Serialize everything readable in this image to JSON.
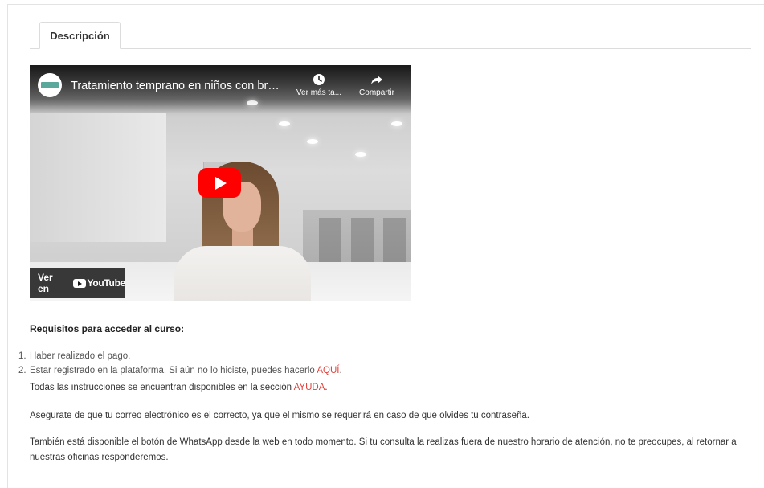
{
  "tabs": [
    {
      "label": "Descripción"
    }
  ],
  "video": {
    "title": "Tratamiento temprano en niños con brac...",
    "channel_logo_icon": "channel-logo-icon",
    "actions": [
      {
        "label": "Ver más ta...",
        "icon": "clock-icon"
      },
      {
        "label": "Compartir",
        "icon": "share-icon"
      }
    ],
    "watch_on_label": "Ver en",
    "youtube_label": "YouTube",
    "play_color": "#ff0000"
  },
  "requirements": {
    "title": "Requisitos para acceder al curso:",
    "items": [
      {
        "number": "1.",
        "text": "Haber realizado el pago."
      },
      {
        "number": "2.",
        "text": "Estar registrado en la plataforma. Si aún no lo hiciste, puedes hacerlo ",
        "link": "AQUÍ",
        "after": "."
      }
    ],
    "instructions": {
      "text": "Todas las instrucciones se encuentran disponibles en la sección ",
      "link": "AYUDA",
      "after": "."
    }
  },
  "paragraphs": [
    "Asegurate de que tu correo electrónico es el correcto, ya que el mismo se requerirá en caso de que olvides tu contraseña.",
    "También está disponible el botón de WhatsApp desde la web en todo momento. Si tu consulta la realizas fuera de nuestro horario de atención, no te preocupes, al retornar a nuestras oficinas responderemos."
  ],
  "colors": {
    "link": "#e4423c",
    "border": "#dcdcdc"
  }
}
